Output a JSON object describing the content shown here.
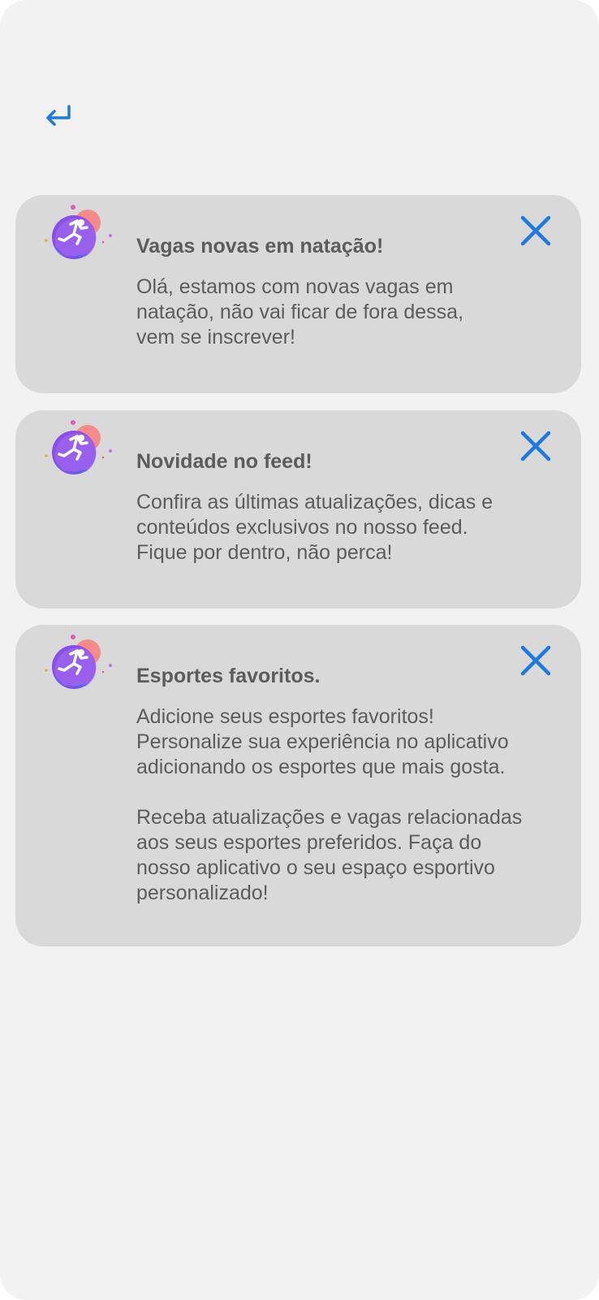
{
  "colors": {
    "accent": "#1e7ae0",
    "card_bg": "#d9d9d9",
    "text": "#5c5c5c",
    "screen_bg": "#f2f2f2"
  },
  "header": {
    "back_icon": "return-arrow-icon"
  },
  "notifications": [
    {
      "title": "Vagas novas em natação!",
      "paragraphs": [
        "Olá, estamos com novas vagas em\nnatação, não vai ficar de fora dessa,\nvem se inscrever!"
      ],
      "logo_icon": "runner-logo-icon",
      "close_icon": "close-icon"
    },
    {
      "title": "Novidade no feed!",
      "paragraphs": [
        "Confira as últimas atualizações, dicas e\nconteúdos exclusivos no nosso feed.\nFique por dentro, não perca!"
      ],
      "logo_icon": "runner-logo-icon",
      "close_icon": "close-icon"
    },
    {
      "title": "Esportes favoritos.",
      "paragraphs": [
        "Adicione seus esportes favoritos!\nPersonalize sua experiência no aplicativo\nadicionando os esportes que mais gosta.",
        "Receba atualizações e vagas relacionadas\naos seus esportes preferidos. Faça do\nnosso aplicativo o seu espaço esportivo\npersonalizado!"
      ],
      "logo_icon": "runner-logo-icon",
      "close_icon": "close-icon"
    }
  ]
}
